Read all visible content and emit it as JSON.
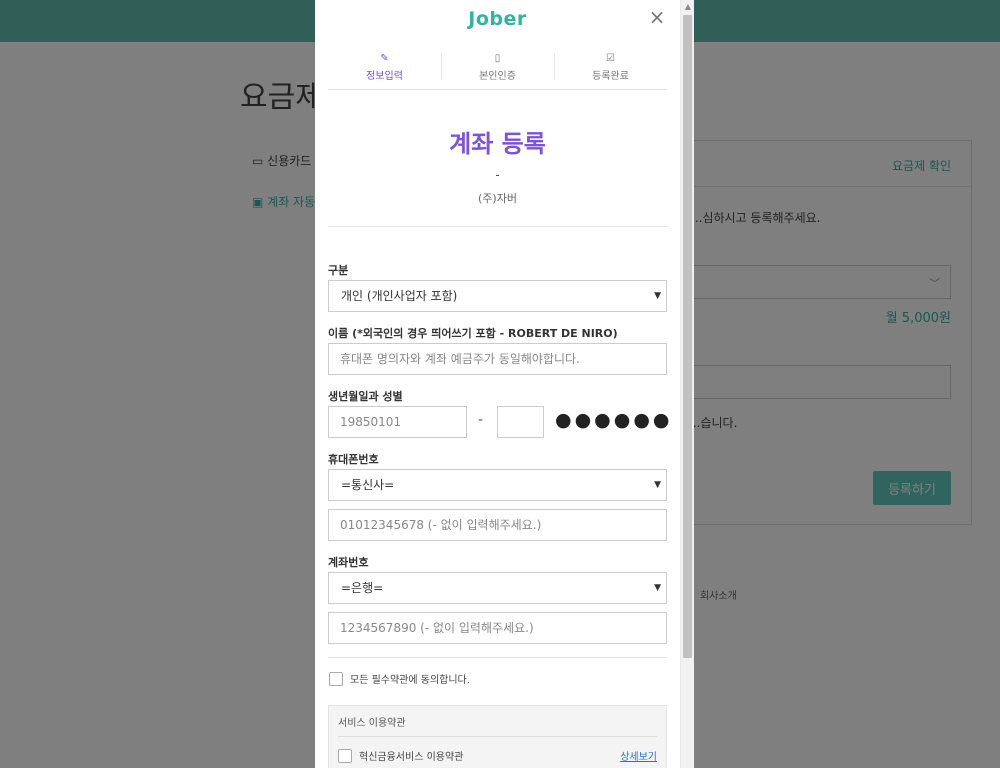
{
  "background": {
    "page_title": "요금제",
    "side_items": [
      "신용카드",
      "계좌 자동"
    ],
    "card_link": "요금제 확인",
    "card_desc": "...심하시고 등록해주세요.",
    "price": "월 5,000원",
    "note": "...습니다.",
    "submit": "등록하기",
    "footer": "회사소개"
  },
  "modal": {
    "logo": "Jober",
    "close_icon": "×",
    "steps": [
      {
        "label": "정보입력",
        "icon": "✎"
      },
      {
        "label": "본인인증",
        "icon": "▯"
      },
      {
        "label": "등록완료",
        "icon": "☑"
      }
    ],
    "title": "계좌 등록",
    "dash": "-",
    "company": "(주)자버",
    "form": {
      "type_label": "구분",
      "type_value": "개인 (개인사업자 포함)",
      "name_label": "이름 (*외국인의 경우 띄어쓰기 포함 - ROBERT DE NIRO)",
      "name_placeholder": "휴대폰 명의자와 계좌 예금주가 동일해야합니다.",
      "birth_label": "생년월일과 성별",
      "birth_placeholder": "19850101",
      "birth_dash": "-",
      "masked": "●●●●●●",
      "phone_label": "휴대폰번호",
      "carrier_value": "=통신사=",
      "phone_placeholder": "01012345678 (- 없이 입력해주세요.)",
      "account_label": "계좌번호",
      "bank_value": "=은행=",
      "account_placeholder": "1234567890 (- 없이 입력해주세요.)"
    },
    "agree_all": "모든 필수약관에 동의합니다.",
    "terms": {
      "header": "서비스 이용약관",
      "item_label": "혁신금융서비스 이용약관",
      "detail_link": "상세보기"
    }
  },
  "colors": {
    "brand": "#2fb5a3",
    "title_purple": "#7b52e0",
    "active_step": "#6c4fd6",
    "link_blue": "#2a6fd6"
  }
}
